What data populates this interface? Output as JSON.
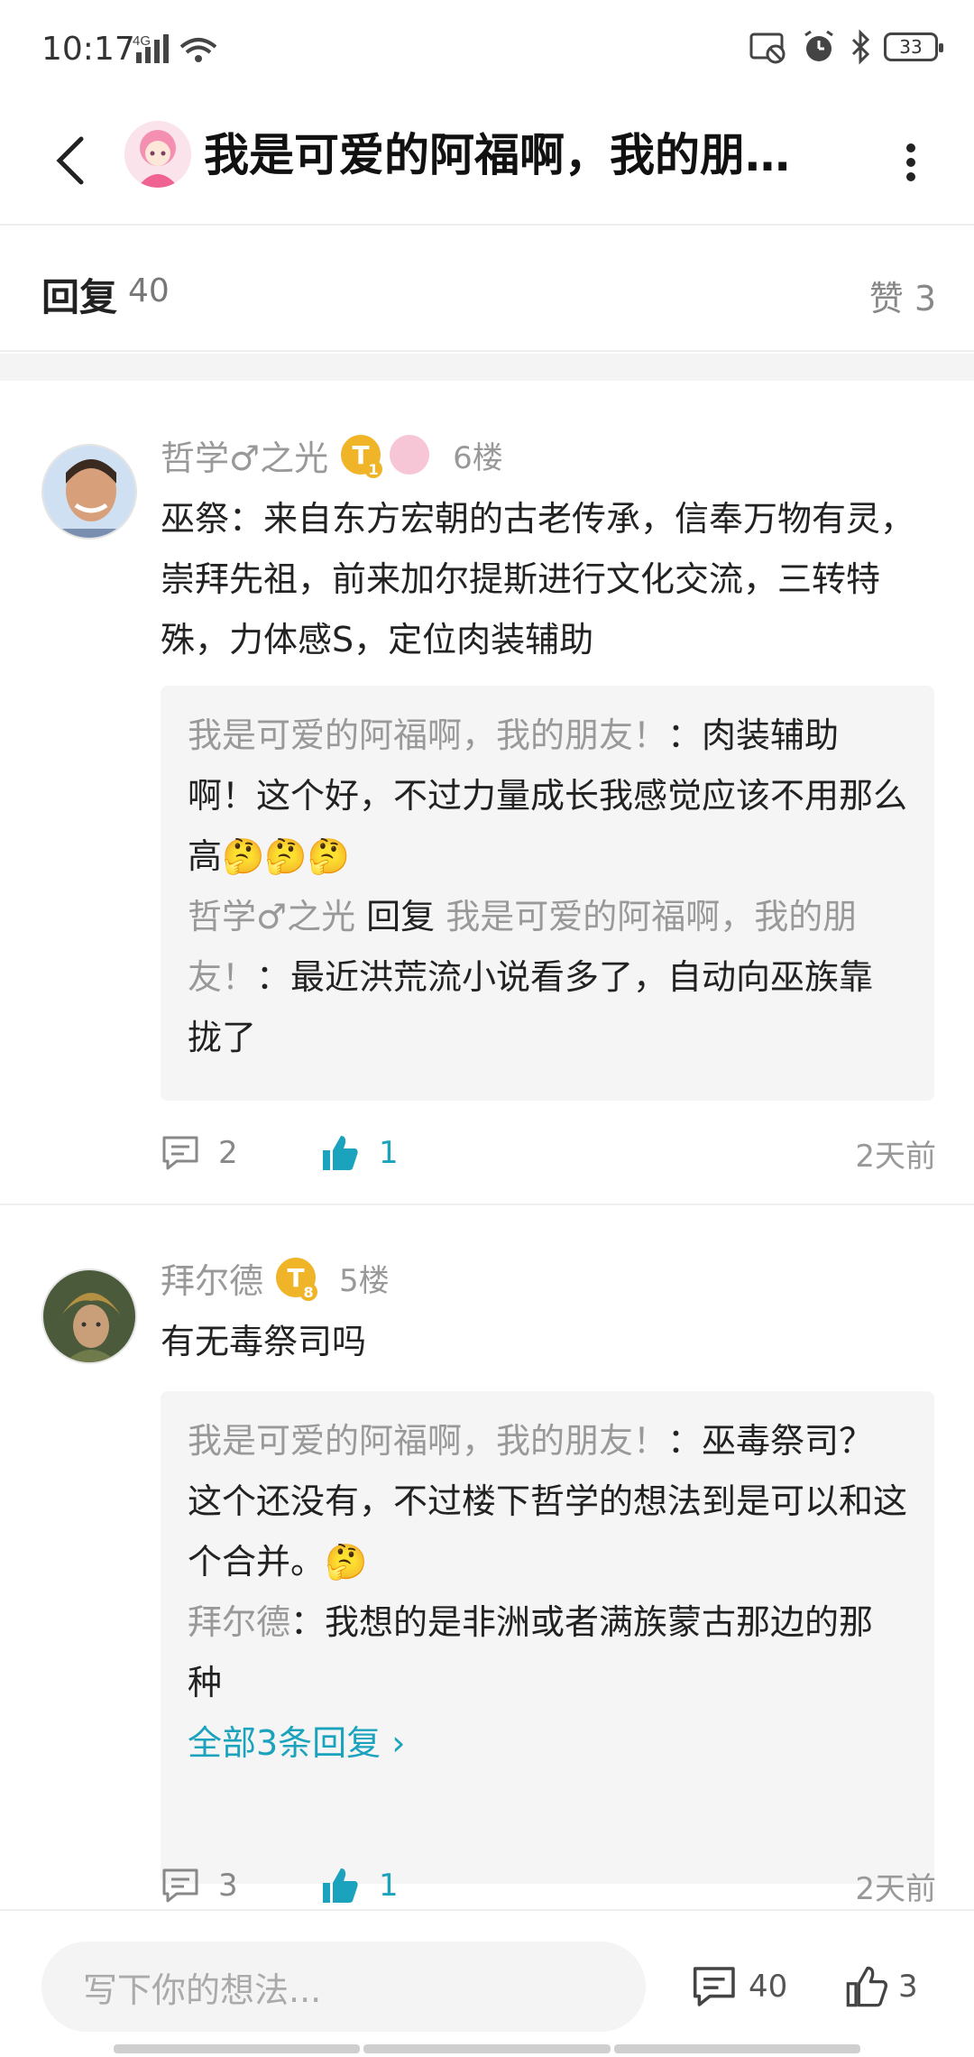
{
  "status_bar": {
    "time": "10:17",
    "network": "4G",
    "battery": "33"
  },
  "header": {
    "title": "我是可爱的阿福啊，我的朋…"
  },
  "reply_bar": {
    "label": "回复",
    "count": "40",
    "like_label": "赞 3"
  },
  "comments": [
    {
      "name": "哲学♂之光",
      "badge": "T",
      "badge_level": "1",
      "floor": "6楼",
      "body": "巫祭：来自东方宏朝的古老传承，信奉万物有灵，崇拜先祖，前来加尔提斯进行文化交流，三转特殊，力体感S，定位肉装辅助",
      "replies": [
        {
          "from": "我是可爱的阿福啊，我的朋友！",
          "text": "：肉装辅助啊！这个好，不过力量成长我感觉应该不用那么高🤔🤔🤔"
        },
        {
          "from": "哲学♂之光",
          "reply_word": "回复",
          "to": "我是可爱的阿福啊，我的朋友！",
          "text": "：最近洪荒流小说看多了，自动向巫族靠拢了"
        }
      ],
      "comment_count": "2",
      "like_count": "1",
      "time": "2天前"
    },
    {
      "name": "拜尔德",
      "badge": "T",
      "badge_level": "8",
      "floor": "5楼",
      "body": "有无毒祭司吗",
      "replies": [
        {
          "from": "我是可爱的阿福啊，我的朋友！",
          "text": "：巫毒祭司？这个还没有，不过楼下哲学的想法到是可以和这个合并。🤔"
        },
        {
          "from": "拜尔德",
          "text": "：我想的是非洲或者满族蒙古那边的那种"
        }
      ],
      "more_replies": "全部3条回复 ›",
      "comment_count": "3",
      "like_count": "1",
      "time": "2天前"
    }
  ],
  "bottom_bar": {
    "input_placeholder": "写下你的想法...",
    "comment_count": "40",
    "like_count": "3"
  },
  "colors": {
    "accent": "#1ba3bd",
    "muted": "#999999",
    "badge": "#f0b429"
  }
}
